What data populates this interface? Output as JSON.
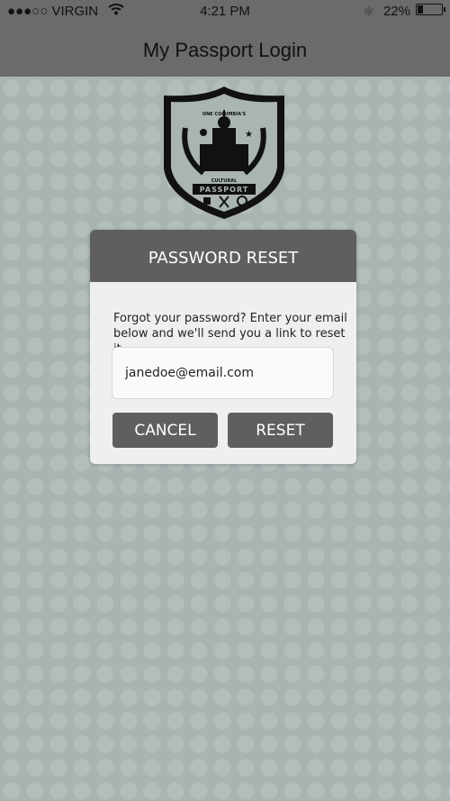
{
  "status_bar": {
    "carrier": "●●●○○ VIRGIN",
    "time": "4:21 PM",
    "battery": "22%",
    "battery_level": 0.22
  },
  "header": {
    "title": "My Passport Login"
  },
  "logo": {
    "top_text": "ONE COLUMBIA'S",
    "ribbon_top": "CULTURAL",
    "ribbon": "PASSPORT"
  },
  "dialog": {
    "title": "PASSWORD RESET",
    "message": "Forgot your password? Enter your email below and we'll send you a link to reset it.",
    "email_value": "janedoe@email.com",
    "cancel_label": "CANCEL",
    "reset_label": "RESET"
  },
  "colors": {
    "header": "#6b6b6b",
    "dialog_header": "#5f5f5f",
    "background": "#a8b3b2"
  }
}
